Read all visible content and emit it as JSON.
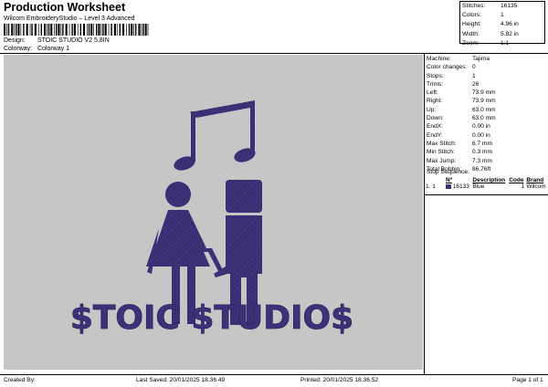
{
  "header": {
    "title": "Production Worksheet",
    "subtitle": "Wilcom EmbroideryStudio – Level 3 Advanced",
    "design_label": "Design:",
    "design_value": "STOIC STUDIO V2 5,8IN",
    "colorway_label": "Colorway:",
    "colorway_value": "Colorway 1"
  },
  "stats": [
    {
      "label": "Stitches:",
      "value": "16135"
    },
    {
      "label": "Colors:",
      "value": "1"
    },
    {
      "label": "Height:",
      "value": "4.96 in"
    },
    {
      "label": "Width:",
      "value": "5.82 in"
    },
    {
      "label": "Zoom:",
      "value": "1:1"
    }
  ],
  "properties": [
    {
      "label": "Machine:",
      "value": "Tajima"
    },
    {
      "label": "Color changes:",
      "value": "0"
    },
    {
      "label": "Stops:",
      "value": "1"
    },
    {
      "label": "Trims:",
      "value": "26"
    },
    {
      "label": "Left:",
      "value": "73.9 mm"
    },
    {
      "label": "Right:",
      "value": "73.9 mm"
    },
    {
      "label": "Up:",
      "value": "63.0 mm"
    },
    {
      "label": "Down:",
      "value": "63.0 mm"
    },
    {
      "label": "EndX:",
      "value": "0.00 in"
    },
    {
      "label": "EndY:",
      "value": "0.00 in"
    },
    {
      "label": "Max Stitch:",
      "value": "6.7 mm"
    },
    {
      "label": "Min Stitch:",
      "value": "0.3 mm"
    },
    {
      "label": "Max Jump:",
      "value": "7.3 mm"
    },
    {
      "label": "Total Bobbin:",
      "value": "86.76ft"
    }
  ],
  "stop_sequence": {
    "title": "Stop Sequence:",
    "headers": [
      "Nº",
      "Description",
      "Code",
      "Brand"
    ],
    "rows": [
      {
        "stop": "1.",
        "n": "1",
        "stitches": "16133",
        "description": "Blue",
        "code": "1",
        "brand": "Wilcom",
        "color": "#3d3178"
      }
    ]
  },
  "design": {
    "text": "$TOIC $TUDIO$",
    "thread_color": "#3d3178",
    "background": "#c6c6c6"
  },
  "footer": {
    "created_by": "Created By:",
    "last_saved": "Last Saved: 20/01/2025 18.36.49",
    "printed": "Printed: 20/01/2025 18.36.52",
    "page": "Page 1 of 1"
  }
}
